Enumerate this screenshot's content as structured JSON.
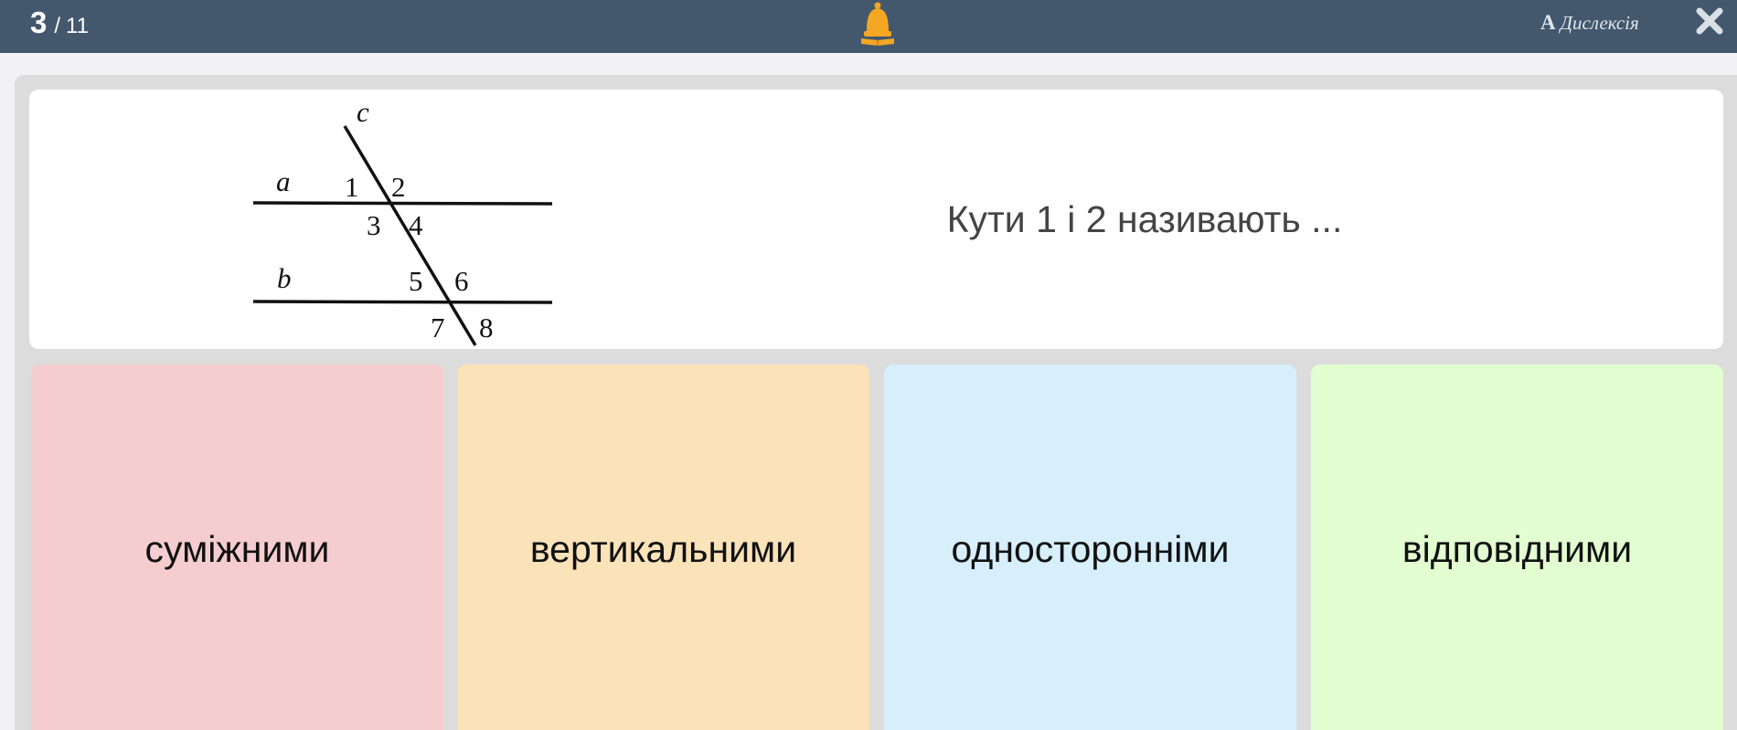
{
  "header": {
    "current": "3",
    "separator": "/",
    "total": "11",
    "dyslexia_icon_letter": "A",
    "dyslexia_label": "Дислексія",
    "bell_icon": "bell-icon",
    "close_icon": "close-icon",
    "bar_color": "#43586d",
    "bell_color": "#f5a623"
  },
  "question": {
    "text": "Кути 1 і 2 називають ...",
    "figure": {
      "transversal_label": "c",
      "line_a_label": "a",
      "line_b_label": "b",
      "angles": [
        "1",
        "2",
        "3",
        "4",
        "5",
        "6",
        "7",
        "8"
      ]
    }
  },
  "answers": [
    {
      "label": "суміжними",
      "color": "#f6cdcf"
    },
    {
      "label": "вертикальними",
      "color": "#fae2b9"
    },
    {
      "label": "односторонніми",
      "color": "#d6effa"
    },
    {
      "label": "відповідними",
      "color": "#e2fdcf"
    }
  ]
}
